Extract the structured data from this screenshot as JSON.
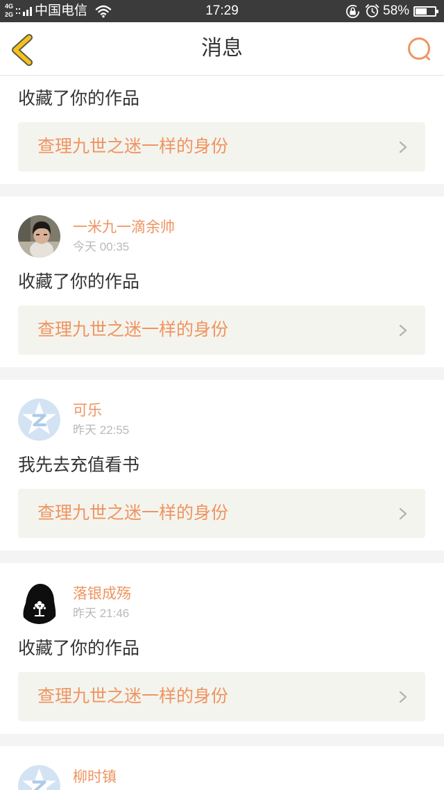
{
  "status_bar": {
    "network_top": "4G",
    "network_bottom": "2G",
    "carrier": "中国电信",
    "time": "17:29",
    "battery_text": "58%",
    "battery_level": 0.58,
    "icons": [
      "signal-icon",
      "wifi-icon",
      "rotation-lock-icon",
      "alarm-icon",
      "battery-icon"
    ]
  },
  "header": {
    "title": "消息",
    "back_icon": "chevron-left-icon",
    "search_icon": "search-icon"
  },
  "colors": {
    "accent": "#ef9460",
    "back_chevron": "#f5c21c",
    "link_box_bg": "#f4f4ee",
    "page_bg": "#f4f4f4",
    "status_bar_bg": "#3b3b3b",
    "time_text": "#b9b9b9",
    "body_text": "#333333"
  },
  "link_chevron_icon": "chevron-right-icon",
  "messages": [
    {
      "text": "收藏了你的作品",
      "book": "查理九世之迷一样的身份"
    },
    {
      "name": "一米九一滴余帅",
      "time": "今天 00:35",
      "avatar": "photo-avatar",
      "text": "收藏了你的作品",
      "book": "查理九世之迷一样的身份"
    },
    {
      "name": "可乐",
      "time": "昨天 22:55",
      "avatar": "default-avatar",
      "text": "我先去充值看书",
      "book": "查理九世之迷一样的身份"
    },
    {
      "name": "落银成殇",
      "time": "昨天 21:46",
      "avatar": "silhouette-avatar",
      "text": "收藏了你的作品",
      "book": "查理九世之迷一样的身份"
    },
    {
      "name": "柳时镇",
      "avatar": "default-avatar"
    }
  ]
}
